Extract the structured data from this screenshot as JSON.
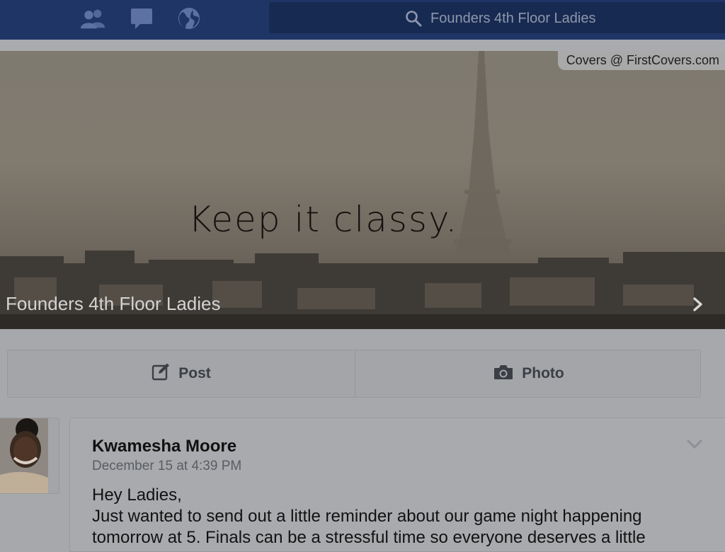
{
  "topbar": {
    "icons": [
      "friends-icon",
      "messages-icon",
      "notifications-globe-icon"
    ],
    "search": {
      "value": "Founders 4th Floor Ladies",
      "icon": "search-icon"
    }
  },
  "cover": {
    "credit": "Covers @ FirstCovers.com",
    "quote": "Keep it classy.",
    "group_name": "Founders 4th Floor Ladies",
    "arrow_icon": "chevron-right-icon"
  },
  "actions": {
    "post_label": "Post",
    "photo_label": "Photo",
    "post_icon": "edit-icon",
    "photo_icon": "camera-icon"
  },
  "post": {
    "author": "Kwamesha Moore",
    "timestamp": "December 15 at 4:39 PM",
    "body_lines": [
      "Hey Ladies,",
      "Just wanted to send out a little reminder about our game night happening",
      "tomorrow at 5. Finals can be a stressful time so everyone deserves a little"
    ],
    "menu_icon": "chevron-down-icon"
  },
  "colors": {
    "topbar": "#1e3566",
    "search_bg": "#172a52",
    "overlay_gray": "#a6a8ab"
  }
}
